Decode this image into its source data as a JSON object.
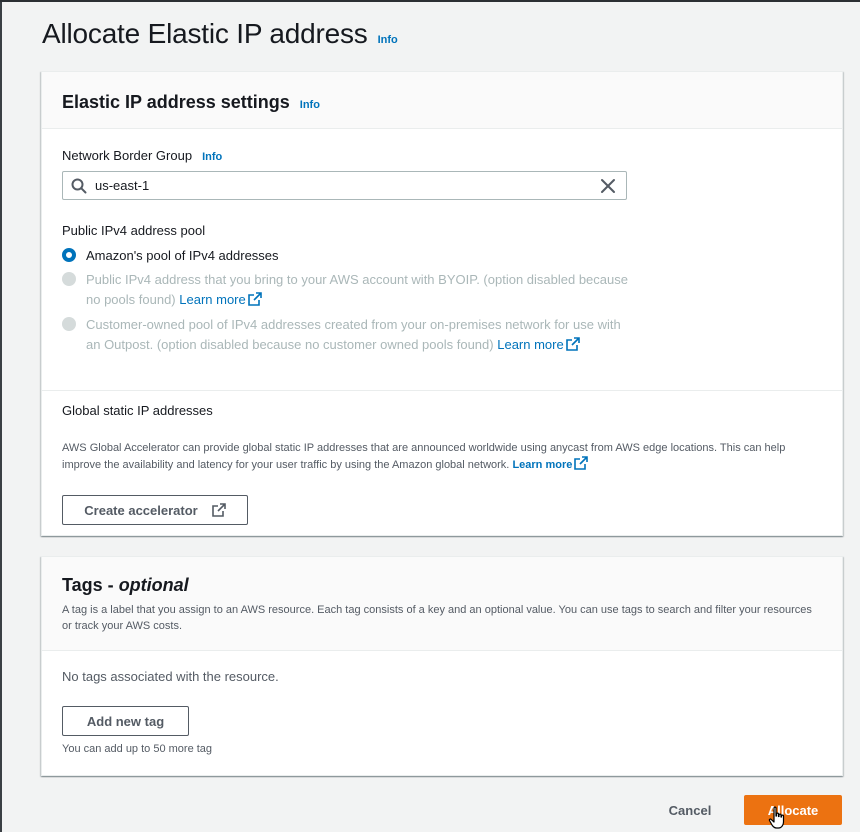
{
  "page": {
    "title": "Allocate Elastic IP address",
    "info": "Info"
  },
  "settings": {
    "heading": "Elastic IP address settings",
    "info": "Info",
    "network_border_group": {
      "label": "Network Border Group",
      "info": "Info",
      "value": "us-east-1"
    },
    "ipv4_pool": {
      "label": "Public IPv4 address pool",
      "options": [
        {
          "text": "Amazon's pool of IPv4 addresses",
          "selected": true,
          "enabled": true
        },
        {
          "text": "Public IPv4 address that you bring to your AWS account with BYOIP. (option disabled because no pools found)",
          "link": "Learn more",
          "selected": false,
          "enabled": false
        },
        {
          "text": "Customer-owned pool of IPv4 addresses created from your on-premises network for use with an Outpost. (option disabled because no customer owned pools found)",
          "link": "Learn more",
          "selected": false,
          "enabled": false
        }
      ]
    },
    "global_static": {
      "label": "Global static IP addresses",
      "description": "AWS Global Accelerator can provide global static IP addresses that are announced worldwide using anycast from AWS edge locations. This can help improve the availability and latency for your user traffic by using the Amazon global network.",
      "link": "Learn more",
      "button": "Create accelerator"
    }
  },
  "tags": {
    "heading": "Tags - ",
    "heading_optional": "optional",
    "description": "A tag is a label that you assign to an AWS resource. Each tag consists of a key and an optional value. You can use tags to search and filter your resources or track your AWS costs.",
    "empty": "No tags associated with the resource.",
    "add_button": "Add new tag",
    "limit": "You can add up to 50 more tag"
  },
  "footer": {
    "cancel": "Cancel",
    "allocate": "Allocate"
  },
  "colors": {
    "primary": "#ec7211",
    "link": "#0073bb",
    "text": "#16191f",
    "muted": "#545b64",
    "disabled": "#aab7b8",
    "background": "#f2f3f3"
  }
}
